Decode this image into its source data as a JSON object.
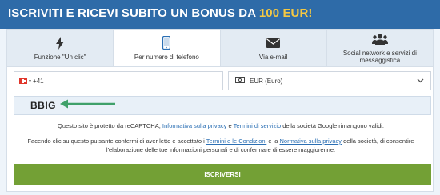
{
  "header": {
    "title": "ISCRIVITI E RICEVI SUBITO UN BONUS DA",
    "amount": "100 EUR!"
  },
  "tabs": [
    {
      "label": "Funzione \"Un clic\"",
      "icon": "lightning-icon"
    },
    {
      "label": "Per numero di telefono",
      "icon": "phone-icon"
    },
    {
      "label": "Via e-mail",
      "icon": "envelope-icon"
    },
    {
      "label": "Social network e servizi di messaggistica",
      "icon": "people-icon"
    }
  ],
  "form": {
    "phone_prefix": "+41",
    "currency": "EUR (Euro)",
    "captcha_text": "BBIG",
    "recaptcha_pre": "Questo sito è protetto da reCAPTCHA; ",
    "recaptcha_link1": "Informativa sulla privacy",
    "recaptcha_mid": " e ",
    "recaptcha_link2": "Termini di servizio",
    "recaptcha_post": " della società Google rimangono validi.",
    "consent_pre": "Facendo clic su questo pulsante confermi di aver letto e accettato i ",
    "consent_link1": "Termini e le Condizioni",
    "consent_mid": " e la ",
    "consent_link2": "Normativa sulla privacy",
    "consent_post": " della società, di consentire l'elaborazione delle tue informazioni personali e di confermare di essere maggiorenne.",
    "submit_label": "ISCRIVERSI"
  },
  "colors": {
    "header_bg": "#2e6ba8",
    "amount": "#f4c842",
    "submit": "#73a035",
    "arrow": "#3fa06a"
  }
}
